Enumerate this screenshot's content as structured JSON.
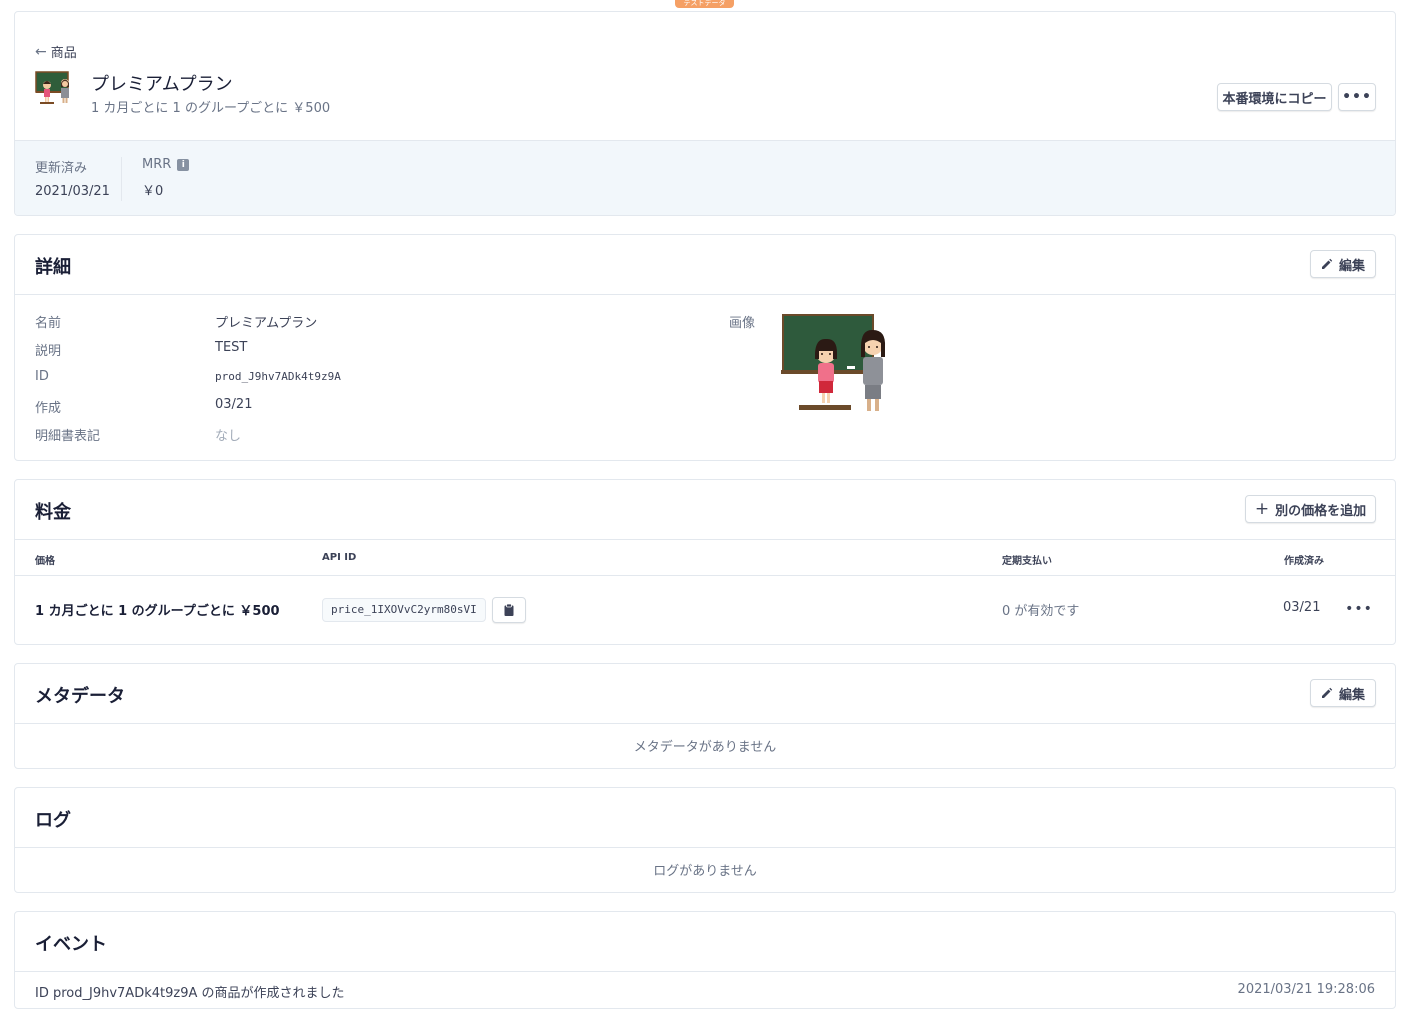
{
  "test_badge": "テストデータ",
  "product": {
    "back_label": "商品",
    "name": "プレミアムプラン",
    "subtitle": "1 カ月ごとに 1 のグループごとに ￥500",
    "copy_button": "本番環境にコピー",
    "more_label": "•••",
    "stats": [
      {
        "label": "更新済み",
        "value": "2021/03/21"
      },
      {
        "label": "MRR",
        "value": "￥0"
      }
    ]
  },
  "details": {
    "title": "詳細",
    "edit_label": "編集",
    "rows": [
      {
        "key": "名前",
        "value": "プレミアムプラン"
      },
      {
        "key": "説明",
        "value": "TEST"
      },
      {
        "key": "ID",
        "value": "prod_J9hv7ADk4t9z9A"
      },
      {
        "key": "作成",
        "value": "03/21"
      },
      {
        "key": "明細書表記",
        "value": "なし"
      }
    ],
    "image_label": "画像"
  },
  "pricing": {
    "title": "料金",
    "add_button": "別の価格を追加",
    "columns": [
      "価格",
      "API ID",
      "定期支払い",
      "作成済み"
    ],
    "rows": [
      {
        "price": "1 カ月ごとに 1 のグループごとに ￥500",
        "api_id": "price_1IXOVvC2yrm80sVI",
        "subscriptions": "0 が有効です",
        "created": "03/21",
        "more": "•••"
      }
    ]
  },
  "metadata": {
    "title": "メタデータ",
    "edit_label": "編集",
    "empty": "メタデータがありません"
  },
  "log": {
    "title": "ログ",
    "empty": "ログがありません"
  },
  "events": {
    "title": "イベント",
    "items": [
      {
        "text": "ID prod_J9hv7ADk4t9z9A の商品が作成されました",
        "time": "2021/03/21 19:28:06"
      }
    ]
  },
  "colors": {
    "accent_badge": "#f5a065",
    "stats_bg": "#f2f7fb",
    "border": "#e3e8ee"
  }
}
